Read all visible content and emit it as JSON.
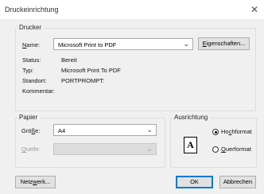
{
  "window": {
    "title": "Druckeinrichtung",
    "close_glyph": "✕"
  },
  "printer_group": {
    "legend": "Drucker",
    "name_label_u": "N",
    "name_label_rest": "ame:",
    "name_value": "Microsoft Print to PDF",
    "properties_button_u": "E",
    "properties_button_rest": "igenschaften...",
    "status_label": "Status:",
    "status_value": "Bereit",
    "type_label": "Typ:",
    "type_value": "Microsoft Print To PDF",
    "location_label": "Standort:",
    "location_value": "PORTPROMPT:",
    "comment_label": "Kommentar:",
    "comment_value": ""
  },
  "paper_group": {
    "legend": "Papier",
    "size_label_pre": "Grö",
    "size_label_u": "ß",
    "size_label_rest": "e:",
    "size_value": "A4",
    "source_label_u": "Q",
    "source_label_rest": "uelle:",
    "source_value": ""
  },
  "orientation_group": {
    "legend": "Ausrichtung",
    "portrait_icon_glyph": "A",
    "portrait_pre": "Ho",
    "portrait_u": "c",
    "portrait_rest": "hformat",
    "landscape_u": "Q",
    "landscape_rest": "uerformat",
    "selected": "portrait"
  },
  "buttons": {
    "network_pre": "Netz",
    "network_u": "w",
    "network_rest": "erk...",
    "ok": "OK",
    "cancel": "Abbrechen"
  },
  "icons": {
    "dropdown": "chevron-down-icon",
    "close": "close-icon",
    "portrait": "portrait-page-icon"
  }
}
